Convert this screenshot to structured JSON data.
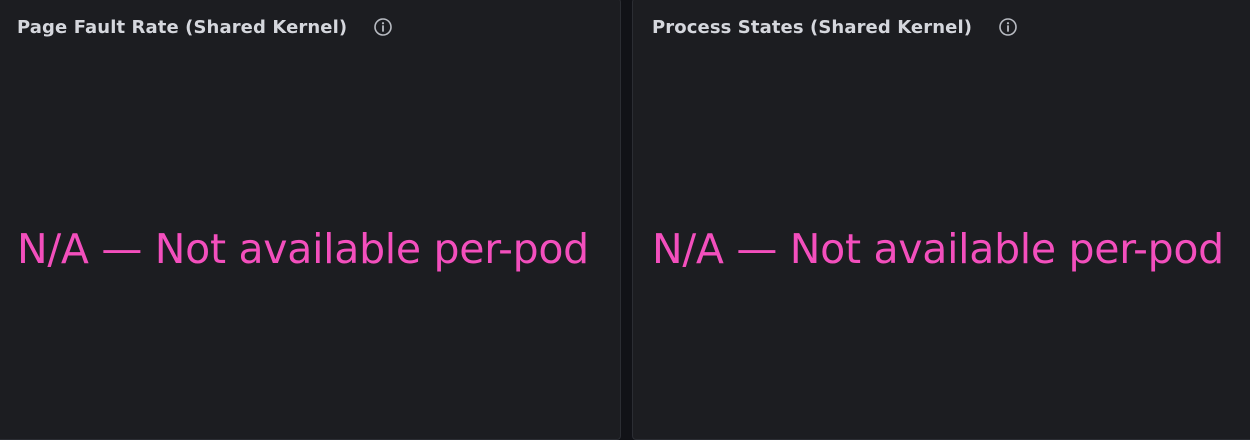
{
  "panels": [
    {
      "title": "Page Fault Rate (Shared Kernel)",
      "value": "N/A — Not available per-pod",
      "info_icon": "info-circle-icon"
    },
    {
      "title": "Process States (Shared Kernel)",
      "value": "N/A — Not available per-pod",
      "info_icon": "info-circle-icon"
    }
  ],
  "colors": {
    "background": "#111217",
    "panel_background": "#1c1d21",
    "title_text": "#d5d7dd",
    "value_text": "#f34fbd",
    "icon": "#b8bbc2"
  }
}
